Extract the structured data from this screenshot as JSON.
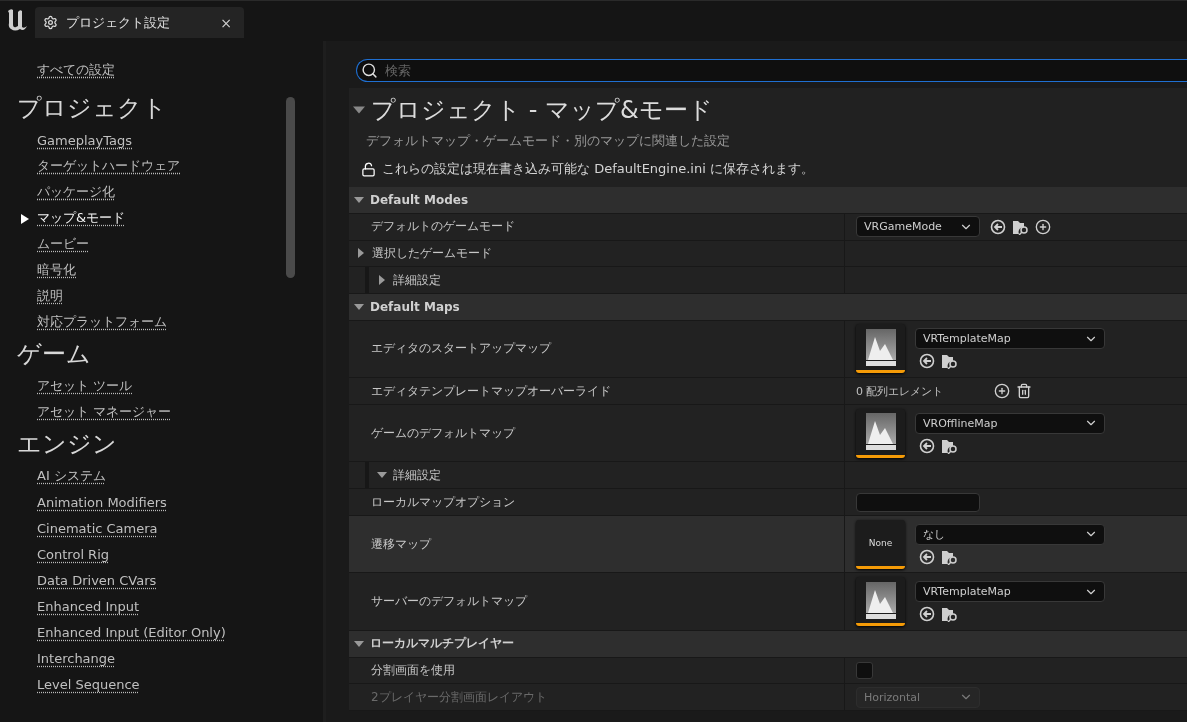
{
  "tab": {
    "title": "プロジェクト設定",
    "close": "×"
  },
  "sidebar": {
    "all_settings": "すべての設定",
    "categories": [
      {
        "title": "プロジェクト",
        "items": [
          {
            "label": "GameplayTags",
            "selected": false
          },
          {
            "label": "ターゲットハードウェア",
            "selected": false
          },
          {
            "label": "パッケージ化",
            "selected": false
          },
          {
            "label": "マップ&モード",
            "selected": true
          },
          {
            "label": "ムービー",
            "selected": false
          },
          {
            "label": "暗号化",
            "selected": false
          },
          {
            "label": "説明",
            "selected": false
          },
          {
            "label": "対応プラットフォーム",
            "selected": false
          }
        ]
      },
      {
        "title": "ゲーム",
        "items": [
          {
            "label": "アセット ツール",
            "selected": false
          },
          {
            "label": "アセット マネージャー",
            "selected": false
          }
        ]
      },
      {
        "title": "エンジン",
        "items": [
          {
            "label": "AI システム",
            "selected": false
          },
          {
            "label": "Animation Modifiers",
            "selected": false
          },
          {
            "label": "Cinematic Camera",
            "selected": false
          },
          {
            "label": "Control Rig",
            "selected": false
          },
          {
            "label": "Data Driven CVars",
            "selected": false
          },
          {
            "label": "Enhanced Input",
            "selected": false
          },
          {
            "label": "Enhanced Input (Editor Only)",
            "selected": false
          },
          {
            "label": "Interchange",
            "selected": false
          },
          {
            "label": "Level Sequence",
            "selected": false
          }
        ]
      }
    ]
  },
  "search": {
    "placeholder": "検索"
  },
  "page": {
    "title": "プロジェクト - マップ&モード",
    "expanded": true,
    "subtitle": "デフォルトマップ・ゲームモード・別のマップに関連した設定",
    "save_note": "これらの設定は現在書き込み可能な DefaultEngine.ini に保存されます。",
    "locked": false
  },
  "sections": [
    {
      "title": "Default Modes",
      "expanded": true,
      "rows": [
        {
          "kind": "property",
          "name": "デフォルトのゲームモード",
          "highlighted": false,
          "disabled": false,
          "value": {
            "kind": "class_picker",
            "selection": "VRGameMode"
          }
        },
        {
          "kind": "category",
          "name": "選択したゲームモード",
          "expanded": false
        },
        {
          "kind": "advanced",
          "name": "詳細設定",
          "expanded": false
        }
      ]
    },
    {
      "title": "Default Maps",
      "expanded": true,
      "rows": [
        {
          "kind": "property",
          "name": "エディタのスタートアップマップ",
          "highlighted": false,
          "disabled": false,
          "value": {
            "kind": "asset_picker",
            "selection": "VRTemplateMap"
          }
        },
        {
          "kind": "property",
          "name": "エディタテンプレートマップオーバーライド",
          "highlighted": false,
          "disabled": false,
          "value": {
            "kind": "array",
            "count_text": "0 配列エレメント"
          }
        },
        {
          "kind": "property",
          "name": "ゲームのデフォルトマップ",
          "highlighted": false,
          "disabled": false,
          "value": {
            "kind": "asset_picker",
            "selection": "VROfflineMap"
          }
        },
        {
          "kind": "advanced",
          "name": "詳細設定",
          "expanded": true,
          "children": [
            {
              "kind": "property",
              "name": "ローカルマップオプション",
              "highlighted": false,
              "disabled": false,
              "value": {
                "kind": "text_field"
              }
            },
            {
              "kind": "property",
              "name": "遷移マップ",
              "highlighted": true,
              "disabled": false,
              "value": {
                "kind": "asset_picker",
                "selection": "なし",
                "thumbnail_label": "None"
              }
            },
            {
              "kind": "property",
              "name": "サーバーのデフォルトマップ",
              "highlighted": false,
              "disabled": false,
              "value": {
                "kind": "asset_picker",
                "selection": "VRTemplateMap"
              }
            }
          ]
        }
      ]
    },
    {
      "title": "ローカルマルチプレイヤー",
      "expanded": true,
      "rows": [
        {
          "kind": "property",
          "name": "分割画面を使用",
          "highlighted": false,
          "disabled": false,
          "value": {
            "kind": "checkbox",
            "checked": false
          }
        },
        {
          "kind": "property",
          "name": "2プレイヤー分割画面レイアウト",
          "highlighted": false,
          "disabled": true,
          "value": {
            "kind": "combo",
            "selection": "Horizontal"
          }
        }
      ]
    }
  ]
}
